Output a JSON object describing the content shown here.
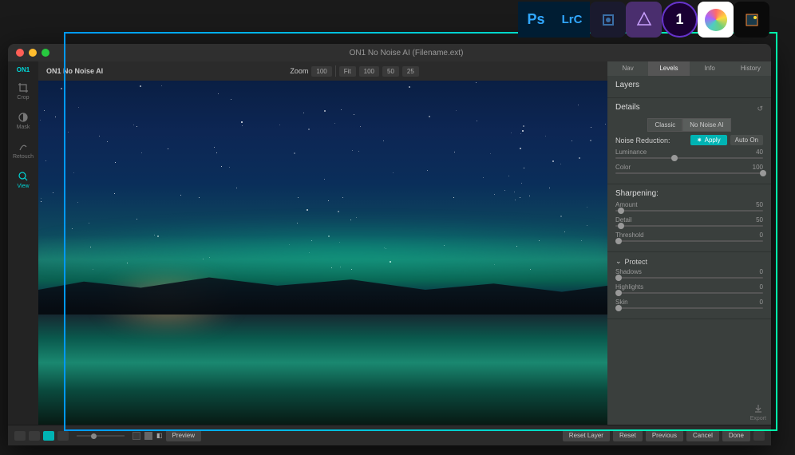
{
  "window_title": "ON1 No Noise AI (Filename.ext)",
  "app_name": "ON1 No Noise AI",
  "plugin_hosts": [
    "Ps",
    "LrC",
    "Elements",
    "Affinity",
    "CaptureOne",
    "Photos",
    "Pixelmator"
  ],
  "tools": [
    {
      "name": "Crop",
      "icon": "crop"
    },
    {
      "name": "Mask",
      "icon": "mask"
    },
    {
      "name": "Retouch",
      "icon": "retouch"
    },
    {
      "name": "View",
      "icon": "view",
      "active": true
    }
  ],
  "zoom": {
    "label": "Zoom",
    "value": "100",
    "presets": [
      "Fit",
      "100",
      "50",
      "25"
    ]
  },
  "panel": {
    "tabs": [
      "Nav",
      "Levels",
      "Info",
      "History"
    ],
    "active_tab": "Levels",
    "layers": "Layers",
    "details": {
      "title": "Details",
      "modes": [
        "Classic",
        "No Noise AI"
      ],
      "active_mode": "No Noise AI"
    },
    "noise": {
      "label": "Noise Reduction:",
      "apply": "Apply",
      "auto": "Auto On",
      "luminance": {
        "label": "Luminance",
        "value": 40
      },
      "color": {
        "label": "Color",
        "value": 100
      }
    },
    "sharpening": {
      "title": "Sharpening:",
      "amount": {
        "label": "Amount",
        "value": 50
      },
      "detail": {
        "label": "Detail",
        "value": 50
      },
      "threshold": {
        "label": "Threshold",
        "value": 0
      }
    },
    "protect": {
      "title": "Protect",
      "shadows": {
        "label": "Shadows",
        "value": 0
      },
      "highlights": {
        "label": "Highlights",
        "value": 0
      },
      "skin": {
        "label": "Skin",
        "value": 0
      }
    }
  },
  "bottom": {
    "preview": "Preview",
    "reset_layer": "Reset Layer",
    "reset": "Reset",
    "previous": "Previous",
    "cancel": "Cancel",
    "done": "Done"
  },
  "export": "Export"
}
